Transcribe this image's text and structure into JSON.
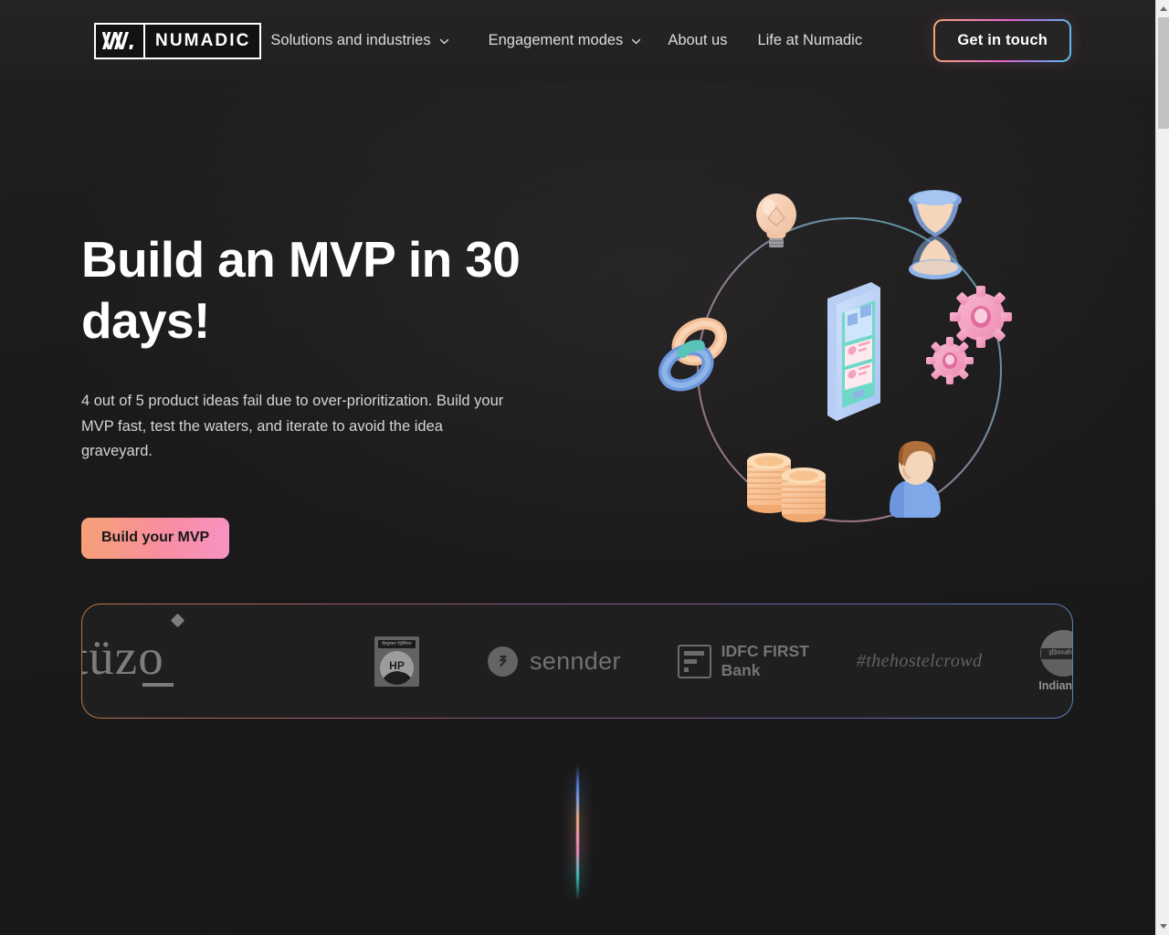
{
  "brand": {
    "mark_icon": "numadic-logo-mark",
    "name": "NUMADIC"
  },
  "nav": {
    "items": [
      {
        "label": "Solutions and industries",
        "has_dropdown": true,
        "icon": "chevron-down-icon"
      },
      {
        "label": "Engagement modes",
        "has_dropdown": true,
        "icon": "chevron-down-icon"
      },
      {
        "label": "About us",
        "has_dropdown": false
      },
      {
        "label": "Life at Numadic",
        "has_dropdown": false
      }
    ],
    "cta_label": "Get in touch"
  },
  "hero": {
    "title": "Build an MVP in 30 days!",
    "subtitle": "4 out of 5 product ideas fail due to over-prioritization. Build your MVP fast, test the waters, and iterate to avoid the idea graveyard.",
    "button_label": "Build your MVP",
    "illustration": {
      "name": "mvp-cycle-illustration",
      "center_icon": "mobile-phone-mockup",
      "ring_icons": [
        "lightbulb-icon",
        "hourglass-icon",
        "gears-icon",
        "person-icon",
        "coin-stacks-icon",
        "chain-links-icon"
      ]
    }
  },
  "clients": {
    "logos": [
      {
        "name": "tuzo-logo",
        "label": "tüzo"
      },
      {
        "name": "hindustan-petroleum-logo",
        "label": "HP",
        "sublabel": "हिन्दुस्तान पेट्रोलियम"
      },
      {
        "name": "sennder-logo",
        "label": "sennder"
      },
      {
        "name": "idfc-first-bank-logo",
        "label": "IDFC FIRST",
        "label2": "Bank"
      },
      {
        "name": "thehostelcrowd-logo",
        "label": "#thehostelcrowd"
      },
      {
        "name": "indianoil-logo",
        "label": "IndianOil",
        "sublabel": "इंडियनऑयल"
      }
    ]
  },
  "colors": {
    "page_background": "#1c1a1b",
    "header_background": "#232122",
    "accent_orange": "#f5a078",
    "accent_pink": "#f892c4",
    "accent_blue": "#56c4e8",
    "text_primary": "#ffffff",
    "text_secondary": "#d6d4d3"
  },
  "browser": {
    "scrollbar": {
      "up_arrow_icon": "scroll-up-arrow-icon",
      "down_arrow_icon": "scroll-down-arrow-icon",
      "thumb": "scrollbar-thumb"
    }
  }
}
